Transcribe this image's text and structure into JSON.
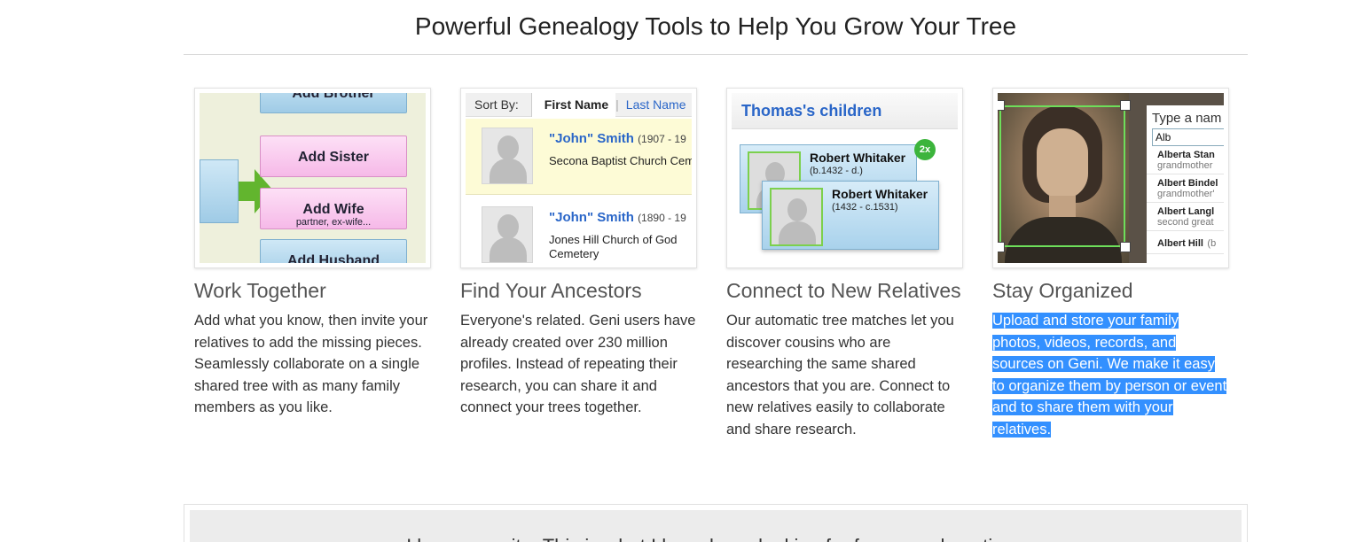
{
  "header": {
    "title": "Powerful Genealogy Tools to Help You Grow Your Tree"
  },
  "features": [
    {
      "title": "Work Together",
      "description": "Add what you know, then invite your relatives to add the missing pieces. Seamlessly collaborate on a single shared tree with as many family members as you like.",
      "thumb": {
        "buttons": [
          "Add Brother",
          "Add Sister",
          "Add Wife",
          "Add Husband"
        ],
        "wife_sub": "partner, ex-wife..."
      }
    },
    {
      "title": "Find Your Ancestors",
      "description": "Everyone's related. Geni users have already created over 230 million profiles. Instead of repeating their research, you can share it and connect your trees together.",
      "thumb": {
        "sort_label": "Sort By:",
        "sort_first": "First Name",
        "sort_last": "Last Name",
        "results": [
          {
            "name": "\"John\" Smith",
            "years": "(1907 - 19",
            "place": "Secona Baptist Church Cem"
          },
          {
            "name": "\"John\" Smith",
            "years": "(1890 - 19",
            "place": "Jones Hill Church of God Cemetery"
          }
        ]
      }
    },
    {
      "title": "Connect to New Relatives",
      "description": "Our automatic tree matches let you discover cousins who are researching the same shared ancestors that you are. Connect to new relatives easily to collaborate and share research.",
      "thumb": {
        "header": "Thomas's children",
        "badge": "2x",
        "cards": [
          {
            "name": "Robert Whitaker",
            "dates": "(b.1432 - d.)"
          },
          {
            "name": "Robert Whitaker",
            "dates": "(1432 - c.1531)"
          }
        ]
      }
    },
    {
      "title": "Stay Organized",
      "description": "Upload and store your family photos, videos, records, and sources on Geni. We make it easy to organize them by person or event and to share them with your relatives.",
      "thumb": {
        "panel_title": "Type a nam",
        "input_value": "Alb",
        "options": [
          {
            "name": "Alberta Stan",
            "relation": "grandmother"
          },
          {
            "name": "Albert Bindel",
            "relation": "grandmother'"
          },
          {
            "name": "Albert Langl",
            "relation": "second great"
          },
          {
            "name": "Albert Hill",
            "relation": "(b"
          }
        ]
      }
    }
  ],
  "testimonial": {
    "text": "I love your site. This is what I have been looking for for a very long time."
  },
  "colors": {
    "selection": "#3390ff",
    "link_blue": "#2a66c8",
    "match_green": "#3cb43c"
  }
}
